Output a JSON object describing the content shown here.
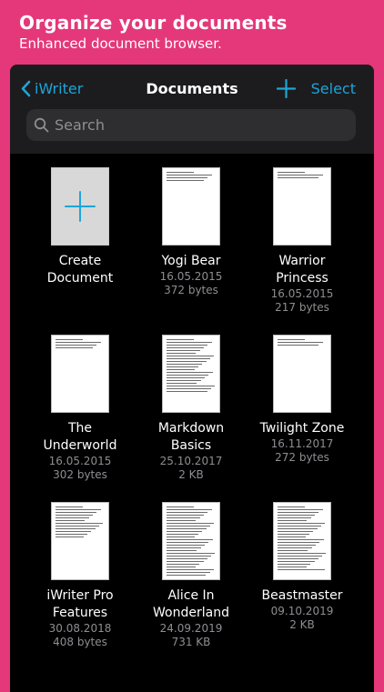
{
  "promo": {
    "title": "Organize your documents",
    "subtitle": "Enhanced document browser."
  },
  "nav": {
    "back_label": "iWriter",
    "title": "Documents",
    "select_label": "Select",
    "accent": "#1ca5d9"
  },
  "search": {
    "placeholder": "Search"
  },
  "documents": [
    {
      "name": "Create\nDocument",
      "date": "",
      "size": "",
      "kind": "create"
    },
    {
      "name": "Yogi Bear",
      "date": "16.05.2015",
      "size": "372 bytes"
    },
    {
      "name": "Warrior\nPrincess",
      "date": "16.05.2015",
      "size": "217 bytes"
    },
    {
      "name": "The\nUnderworld",
      "date": "16.05.2015",
      "size": "302 bytes"
    },
    {
      "name": "Markdown\nBasics",
      "date": "25.10.2017",
      "size": "2 KB"
    },
    {
      "name": "Twilight Zone",
      "date": "16.11.2017",
      "size": "272 bytes"
    },
    {
      "name": "iWriter Pro\nFeatures",
      "date": "30.08.2018",
      "size": "408 bytes"
    },
    {
      "name": "Alice In\nWonderland",
      "date": "24.09.2019",
      "size": "731 KB"
    },
    {
      "name": "Beastmaster",
      "date": "09.10.2019",
      "size": "2 KB"
    }
  ]
}
